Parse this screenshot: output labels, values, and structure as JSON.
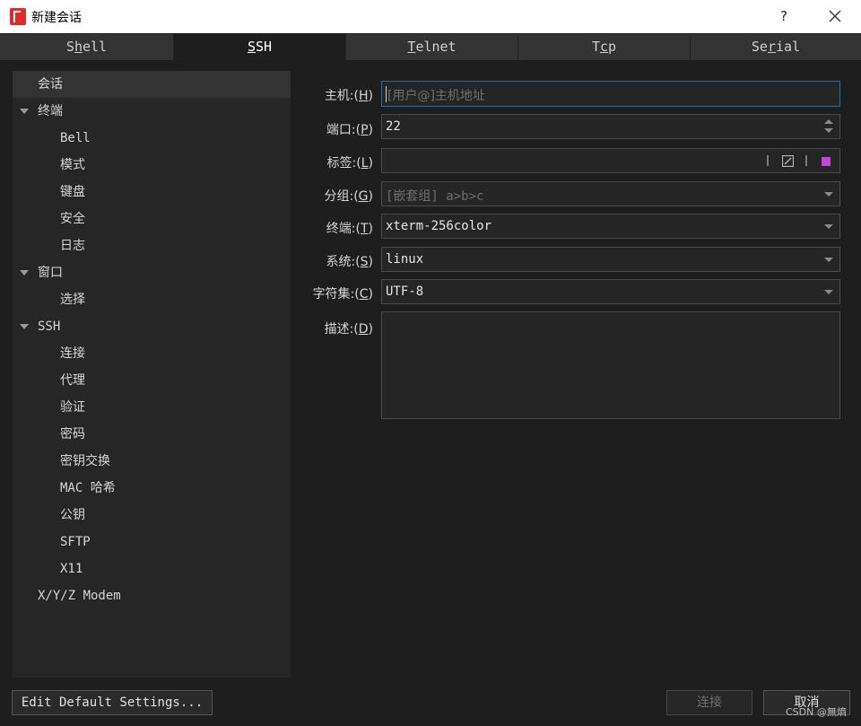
{
  "window": {
    "title": "新建会话",
    "help_label": "?"
  },
  "tabs": [
    {
      "pre": "S",
      "u": "h",
      "post": "ell"
    },
    {
      "pre": "",
      "u": "S",
      "post": "SH"
    },
    {
      "pre": "",
      "u": "T",
      "post": "elnet"
    },
    {
      "pre": "T",
      "u": "c",
      "post": "p"
    },
    {
      "pre": "Se",
      "u": "r",
      "post": "ial"
    }
  ],
  "active_tab_index": 1,
  "tree": {
    "session": "会话",
    "terminal": "终端",
    "bell": "Bell",
    "mode": "模式",
    "keyboard": "键盘",
    "security": "安全",
    "log": "日志",
    "window": "窗口",
    "selection": "选择",
    "ssh": "SSH",
    "connection": "连接",
    "proxy": "代理",
    "auth": "验证",
    "password": "密码",
    "kex": "密钥交换",
    "mac": "MAC 哈希",
    "public_key": "公钥",
    "sftp": "SFTP",
    "x11": "X11",
    "modem": "X/Y/Z Modem"
  },
  "form": {
    "host": {
      "label_pre": "主机:(",
      "label_u": "H",
      "label_post": ")",
      "placeholder": "[用户@]主机地址",
      "value": ""
    },
    "port": {
      "label_pre": "端口:(",
      "label_u": "P",
      "label_post": ")",
      "value": "22"
    },
    "tag": {
      "label_pre": "标签:(",
      "label_u": "L",
      "label_post": ")",
      "value": "",
      "color": "#c248d6"
    },
    "group": {
      "label_pre": "分组:(",
      "label_u": "G",
      "label_post": ")",
      "placeholder": "[嵌套组] a>b>c"
    },
    "terminal": {
      "label_pre": "终端:(",
      "label_u": "T",
      "label_post": ")",
      "value": "xterm-256color"
    },
    "system": {
      "label_pre": "系统:(",
      "label_u": "S",
      "label_post": ")",
      "value": "linux"
    },
    "charset": {
      "label_pre": "字符集:(",
      "label_u": "C",
      "label_post": ")",
      "value": "UTF-8"
    },
    "description": {
      "label_pre": "描述:(",
      "label_u": "D",
      "label_post": ")",
      "value": ""
    }
  },
  "buttons": {
    "edit_defaults": "Edit Default Settings...",
    "connect": "连接",
    "cancel": "取消"
  },
  "watermark": "CSDN @無熵"
}
